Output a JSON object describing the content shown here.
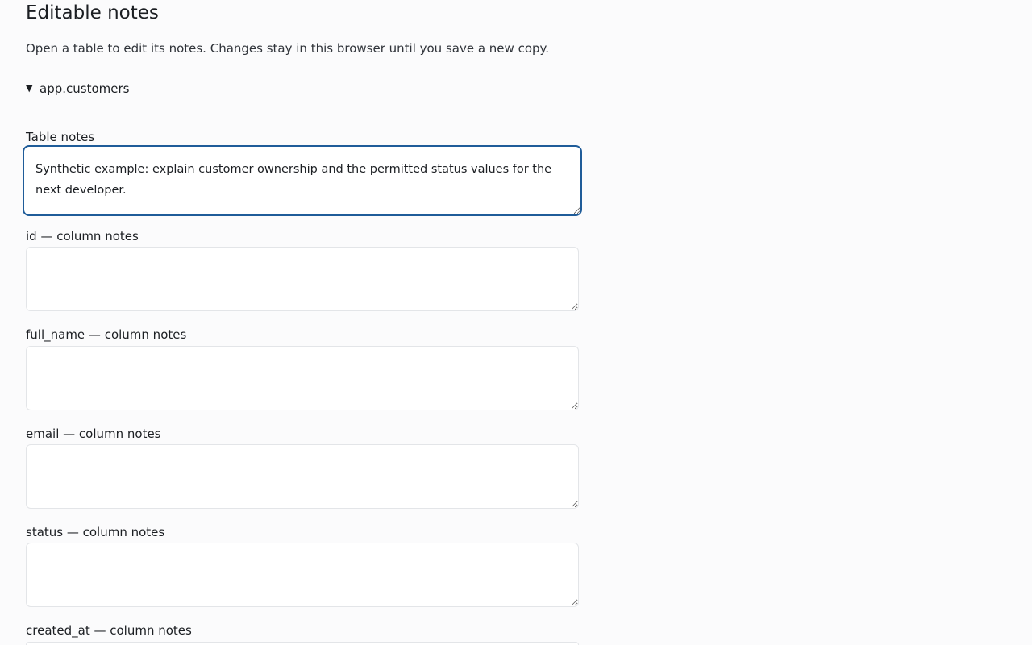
{
  "page": {
    "title": "Editable notes",
    "intro": "Open a table to edit its notes. Changes stay in this browser until you save a new copy."
  },
  "table_section": {
    "expanded": true,
    "toggle_icon": "triangle-down-icon",
    "name": "app.customers",
    "table_notes_label": "Table notes",
    "table_notes_value": "Synthetic example: explain customer ownership and the permitted status values for the next developer.",
    "columns": [
      {
        "label": "id — column notes",
        "value": ""
      },
      {
        "label": "full_name — column notes",
        "value": ""
      },
      {
        "label": "email — column notes",
        "value": ""
      },
      {
        "label": "status — column notes",
        "value": ""
      },
      {
        "label": "created_at — column notes",
        "value": ""
      }
    ]
  },
  "colors": {
    "focus_border": "#1f5c99",
    "page_background": "#fbfbfc"
  }
}
